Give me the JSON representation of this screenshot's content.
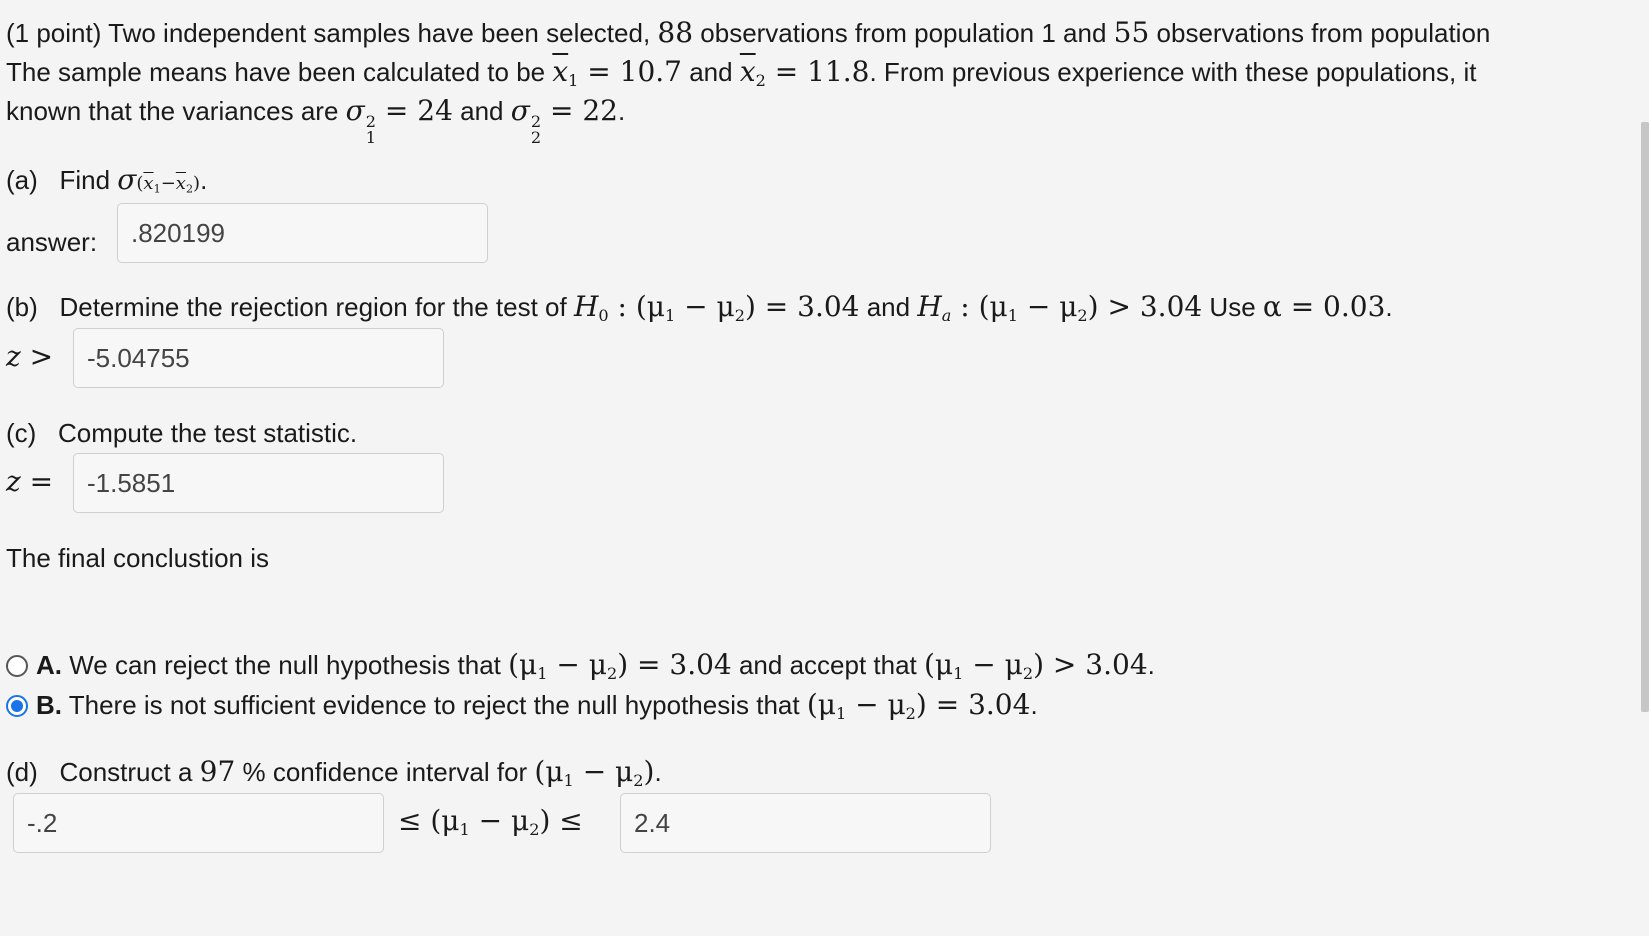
{
  "problem": {
    "intro_1a": "(1 point) Two independent samples have been selected, ",
    "n1": "88",
    "intro_1b": " observations from population 1 and ",
    "n2": "55",
    "intro_1c": " observations from population",
    "intro_2a": "The sample means have been calculated to be ",
    "xbar1_eq": " = 10.7",
    "and_1": " and ",
    "xbar2_eq": " = 11.8",
    "intro_2b": ". From previous experience with these populations, it",
    "intro_3a": "known that the variances are ",
    "var1_eq": " = 24",
    "and_2": " and ",
    "var2_eq": " = 22",
    "intro_3b": "."
  },
  "part_a": {
    "label": "(a)",
    "text": "Find ",
    "answer_label": "answer:",
    "answer_value": ".820199"
  },
  "part_b": {
    "label": "(b)",
    "text_1": "Determine the rejection region for the test of ",
    "h0_eq": " : (μ",
    "h0_rest": ") = 3.04",
    "and": " and ",
    "ha_eq": " : (μ",
    "ha_rest": ") > 3.04",
    "use": " Use ",
    "alpha_eq": "α = 0.03",
    "period": ".",
    "z_prefix": "z >",
    "answer_value": "-5.04755"
  },
  "part_c": {
    "label": "(c)",
    "text": "Compute the test statistic.",
    "z_prefix": "z =",
    "answer_value": "-1.5851"
  },
  "conclusion": {
    "text": "The final conclustion is",
    "options": [
      {
        "letter": "A.",
        "text_1": " We can reject the null hypothesis that ",
        "math_1": "= 3.04",
        "text_2": " and accept that ",
        "math_2": "> 3.04",
        "text_3": ".",
        "selected": false
      },
      {
        "letter": "B.",
        "text_1": " There is not sufficient evidence to reject the null hypothesis that ",
        "math_1": "= 3.04",
        "text_3": ".",
        "selected": true
      }
    ]
  },
  "part_d": {
    "label": "(d)",
    "text_1": "Construct a ",
    "conf": "97",
    "text_2": " % confidence interval for ",
    "period": ".",
    "lower_value": "-.2",
    "middle": "≤ (μ",
    "middle_end": ") ≤",
    "upper_value": "2.4"
  },
  "colors": {
    "accent": "#1a73e8",
    "background": "#f4f4f4"
  }
}
